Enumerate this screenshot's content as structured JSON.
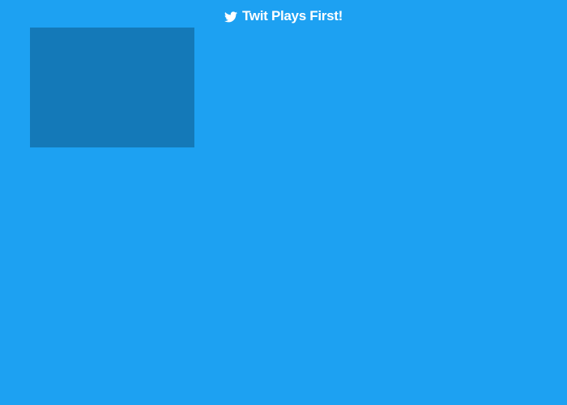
{
  "header": {
    "icon": "twitter-bird-icon",
    "title": "Twit Plays First!"
  },
  "colors": {
    "background": "#1da1f2",
    "panel": "#1479b8",
    "text": "#ffffff"
  }
}
